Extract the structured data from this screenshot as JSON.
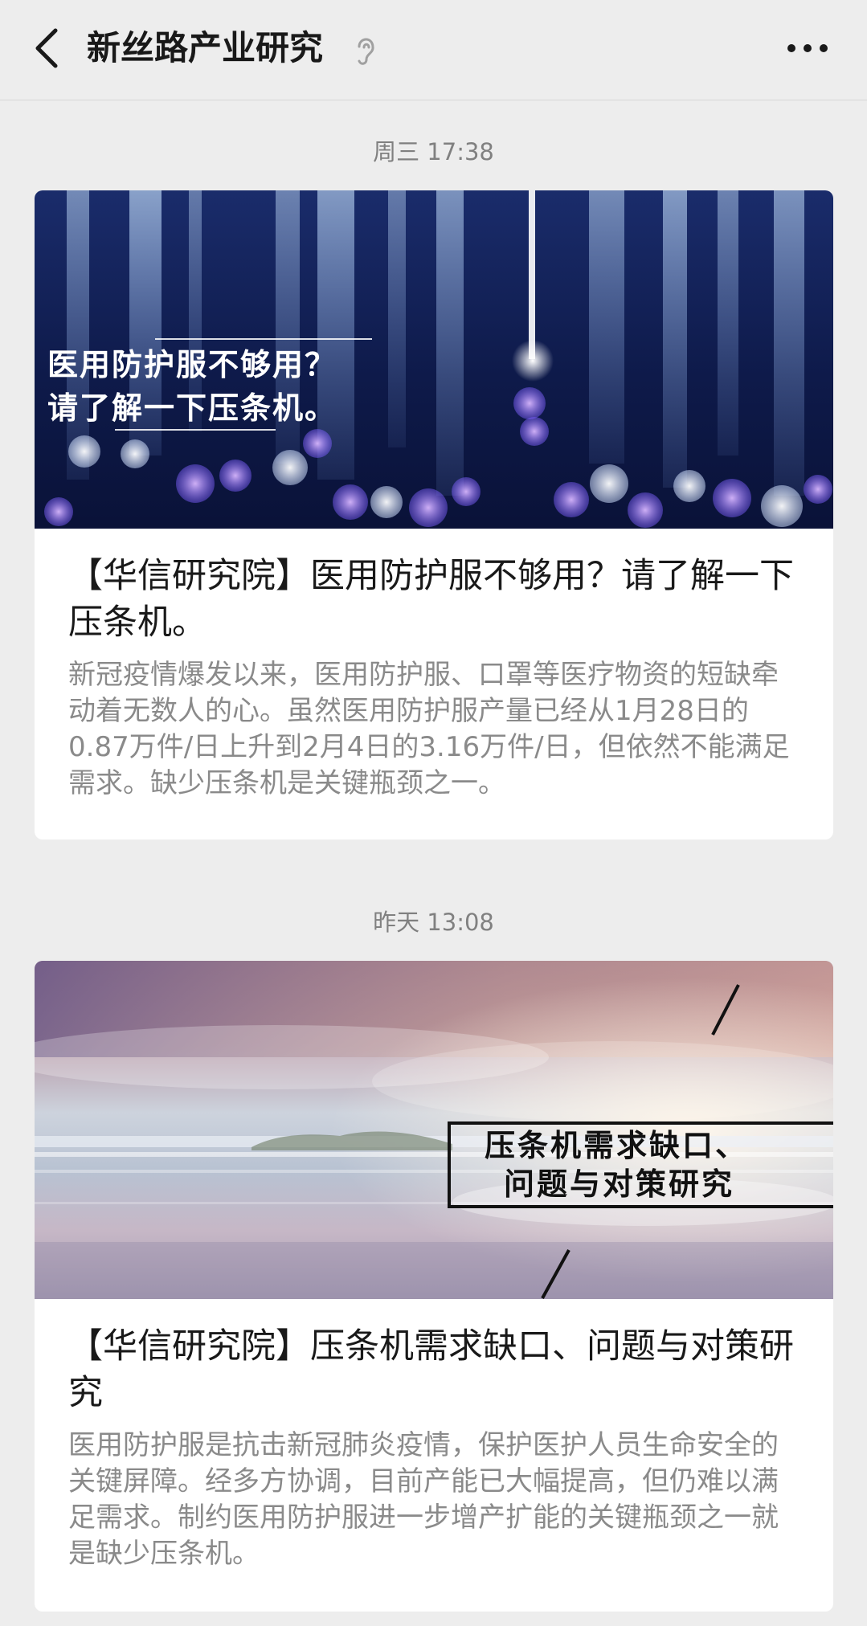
{
  "header": {
    "title": "新丝路产业研究",
    "back_icon": "chevron-left-icon",
    "listen_icon": "ear-icon",
    "more_icon": "more-dots-icon"
  },
  "messages": [
    {
      "timestamp": "周三 17:38",
      "cover_text_line1": "医用防护服不够用？",
      "cover_text_line2": "请了解一下压条机。",
      "title": "【华信研究院】医用防护服不够用？请了解一下压条机。",
      "description": "新冠疫情爆发以来，医用防护服、口罩等医疗物资的短缺牵动着无数人的心。虽然医用防护服产量已经从1月28日的0.87万件/日上升到2月4日的3.16万件/日，但依然不能满足需求。缺少压条机是关键瓶颈之一。"
    },
    {
      "timestamp": "昨天 13:08",
      "cover_text_line1": "压条机需求缺口、",
      "cover_text_line2": "问题与对策研究",
      "title": "【华信研究院】压条机需求缺口、问题与对策研究",
      "description": "医用防护服是抗击新冠肺炎疫情，保护医护人员生命安全的关键屏障。经多方协调，目前产能已大幅提高，但仍难以满足需求。制约医用防护服进一步增产扩能的关键瓶颈之一就是缺少压条机。"
    }
  ],
  "colors": {
    "background": "#ededed",
    "card": "#ffffff",
    "title_text": "#191919",
    "desc_text": "#8a8a8a",
    "timestamp_text": "#808080"
  }
}
